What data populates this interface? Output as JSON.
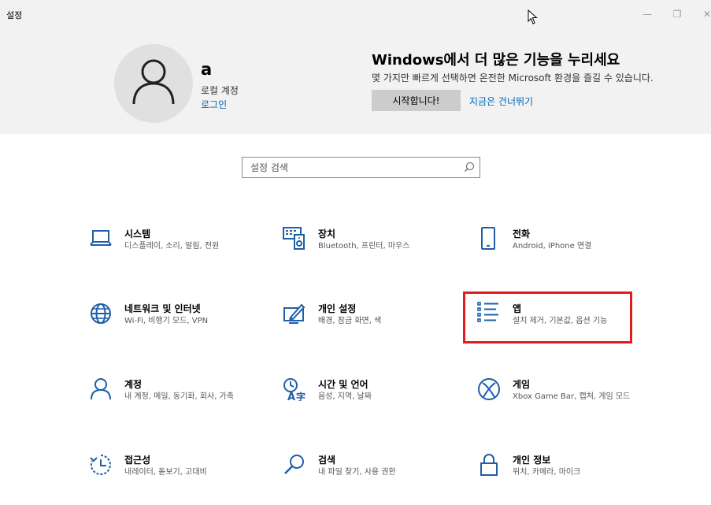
{
  "window": {
    "title": "설정",
    "minimize_glyph": "—",
    "maximize_glyph": "❐",
    "close_glyph": "✕"
  },
  "account": {
    "name": "a",
    "type": "로컬 계정",
    "signin": "로그인"
  },
  "promo": {
    "title": "Windows에서 더 많은 기능을 누리세요",
    "description": "몇 가지만 빠르게 선택하면 온전한 Microsoft 환경을 즐길 수 있습니다.",
    "start_button": "시작합니다!",
    "skip_link": "지금은 건너뛰기"
  },
  "search": {
    "placeholder": "설정 검색"
  },
  "categories": [
    {
      "name": "시스템",
      "desc": "디스플레이, 소리, 알림, 전원",
      "icon": "laptop-icon"
    },
    {
      "name": "장치",
      "desc": "Bluetooth, 프린터, 마우스",
      "icon": "devices-icon"
    },
    {
      "name": "전화",
      "desc": "Android, iPhone 연결",
      "icon": "phone-icon"
    },
    {
      "name": "네트워크 및 인터넷",
      "desc": "Wi-Fi, 비행기 모드, VPN",
      "icon": "globe-icon"
    },
    {
      "name": "개인 설정",
      "desc": "배경, 잠금 화면, 색",
      "icon": "personalization-icon"
    },
    {
      "name": "앱",
      "desc": "설치 제거, 기본값, 옵션 기능",
      "icon": "apps-list-icon"
    },
    {
      "name": "계정",
      "desc": "내 계정, 메일, 동기화, 회사, 가족",
      "icon": "person-icon"
    },
    {
      "name": "시간 및 언어",
      "desc": "음성, 지역, 날짜",
      "icon": "time-language-icon"
    },
    {
      "name": "게임",
      "desc": "Xbox Game Bar, 캡처, 게임 모드",
      "icon": "xbox-icon"
    },
    {
      "name": "접근성",
      "desc": "내레이터, 돋보기, 고대비",
      "icon": "ease-of-access-icon"
    },
    {
      "name": "검색",
      "desc": "내 파일 찾기, 사용 권한",
      "icon": "search-magnifier-icon"
    },
    {
      "name": "개인 정보",
      "desc": "위치, 카메라, 마이크",
      "icon": "lock-icon"
    }
  ],
  "colors": {
    "accent_link": "#0063b1",
    "icon_blue": "#1f5fa8",
    "highlight_box": "#e21c1c"
  }
}
